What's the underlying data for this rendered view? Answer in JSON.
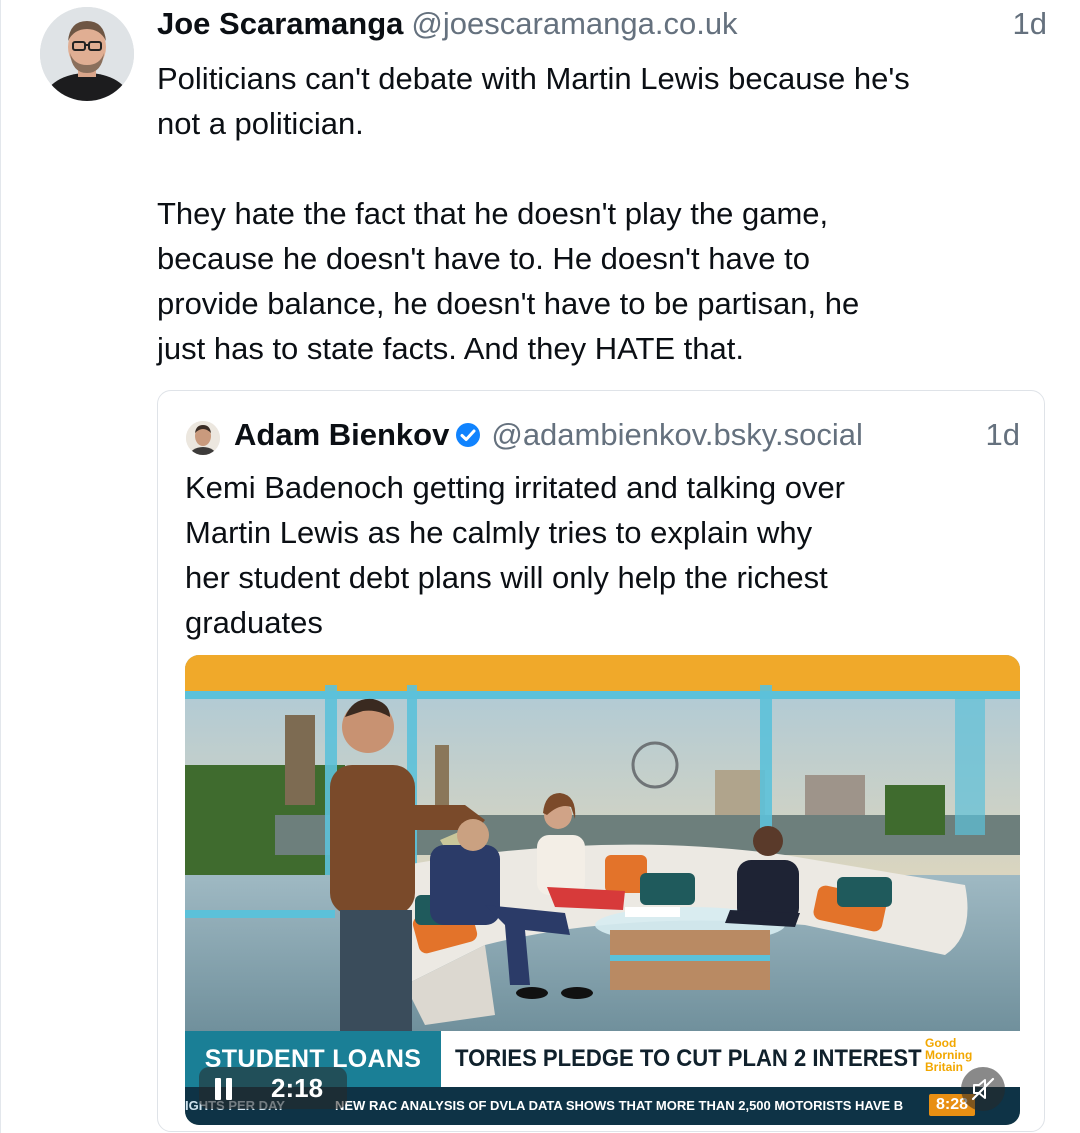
{
  "post": {
    "author_name": "Joe Scaramanga",
    "author_handle": "@joescaramanga.co.uk",
    "time": "1d",
    "paragraphs": [
      "Politicians can't debate with Martin Lewis because he's\nnot a politician.",
      "They hate the fact that he doesn't play the game,\nbecause he doesn't have to. He doesn't have to\nprovide balance, he doesn't have to be partisan, he\njust has to state facts. And they HATE that."
    ]
  },
  "quote": {
    "author_name": "Adam Bienkov",
    "author_handle": "@adambienkov.bsky.social",
    "time": "1d",
    "verified": true,
    "text": "Kemi Badenoch getting irritated and talking over\nMartin Lewis as he calmly tries to explain why\nher student debt plans will only help the richest\ngraduates"
  },
  "video": {
    "ticker_section": "STUDENT LOANS",
    "ticker_headline": "TORIES PLEDGE TO CUT PLAN 2 INTEREST",
    "logo_lines": [
      "Good",
      "Morning",
      "Britain"
    ],
    "bottom_left": "IGHTS PER DAY",
    "bottom_news": "NEW RAC ANALYSIS OF DVLA DATA SHOWS THAT MORE THAN 2,500 MOTORISTS HAVE B",
    "clock": "8:28",
    "playback_time": "2:18",
    "playing": true,
    "muted": true
  },
  "colors": {
    "text_primary": "#0b0f14",
    "text_secondary": "#65717e",
    "verified_blue": "#1083fe",
    "ticker_teal": "#1a7f96",
    "ticker_navy": "#0e3346",
    "gmb_orange": "#e88f13"
  },
  "icons": {
    "verified": "verified-check-icon",
    "pause": "pause-icon",
    "mute": "speaker-muted-icon"
  }
}
